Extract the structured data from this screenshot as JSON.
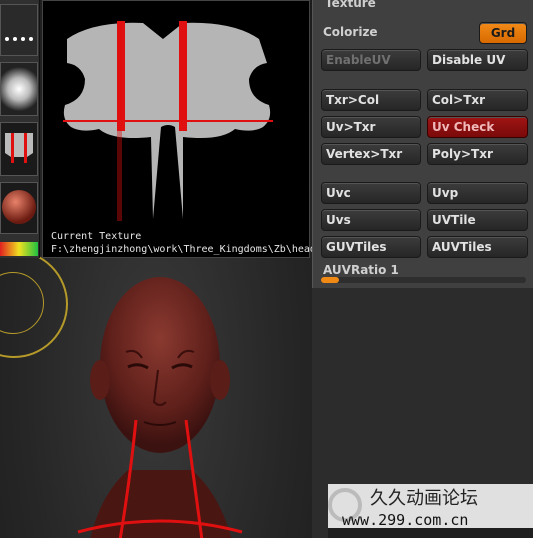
{
  "texture_preview": {
    "caption_label": "Current Texture",
    "caption_path": "F:\\zhengjinzhong\\work\\Three_Kingdoms\\Zb\\head"
  },
  "palette": {
    "title": "Texture",
    "colorize_label": "Colorize",
    "grd_label": "Grd",
    "buttons": {
      "enable_uv": "EnableUV",
      "disable_uv": "Disable UV",
      "txr_col": "Txr>Col",
      "col_txr": "Col>Txr",
      "uv_txr": "Uv>Txr",
      "uv_check": "Uv Check",
      "vertex_txr": "Vertex>Txr",
      "poly_txr": "Poly>Txr",
      "uvc": "Uvc",
      "uvp": "Uvp",
      "uvs": "Uvs",
      "uvtile": "UVTile",
      "guvtiles": "GUVTiles",
      "auvtiles": "AUVTiles"
    },
    "auvratio_label": "AUVRatio 1",
    "auvratio_value": 0.09
  },
  "watermark": {
    "title": "久久动画论坛",
    "url": "www.299.com.cn"
  },
  "colors": {
    "accent_orange": "#f08a14",
    "uv_check_red": "#9a1212",
    "seam_red": "#e01010"
  }
}
